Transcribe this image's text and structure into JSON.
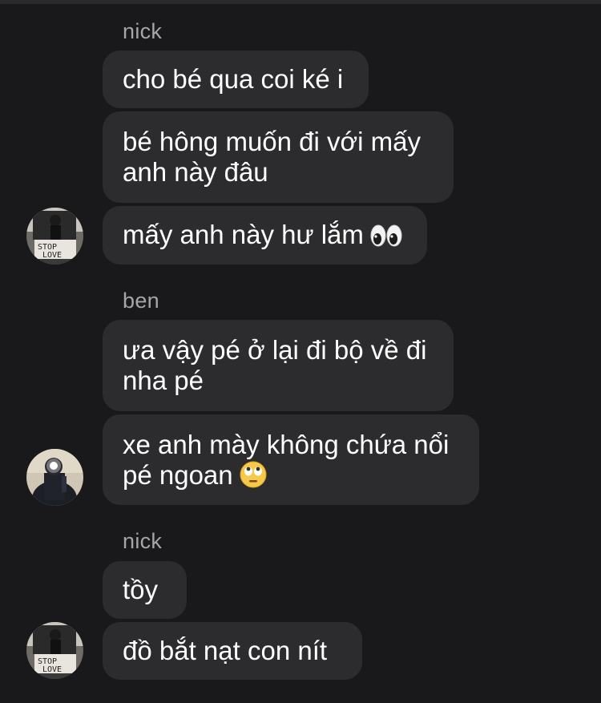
{
  "chat": {
    "groups": [
      {
        "sender": "nick",
        "messages": [
          {
            "lines": [
              "cho bé qua coi ké i"
            ]
          },
          {
            "lines": [
              "bé hông muốn đi với mấy",
              "anh này đâu"
            ]
          },
          {
            "lines": [
              "mấy anh này hư lắm"
            ],
            "emoji": "eyes-emoji"
          }
        ],
        "avatar": "avatar-graffiti"
      },
      {
        "sender": "ben",
        "messages": [
          {
            "lines": [
              "ưa vậy pé ở lại đi bộ về đi",
              "nha pé"
            ]
          },
          {
            "lines": [
              "xe anh mày không chứa nổi",
              "pé ngoan"
            ],
            "emoji": "eye-roll-emoji"
          }
        ],
        "avatar": "avatar-dark-person"
      },
      {
        "sender": "nick",
        "messages": [
          {
            "lines": [
              "tồy"
            ]
          },
          {
            "lines": [
              "đồ bắt nạt con nít"
            ]
          }
        ],
        "avatar": "avatar-graffiti"
      }
    ]
  },
  "theme": {
    "background": "#19191b",
    "bubble": "#2c2c2f",
    "sender_name": "#a5a5aa",
    "text": "#ffffff"
  }
}
